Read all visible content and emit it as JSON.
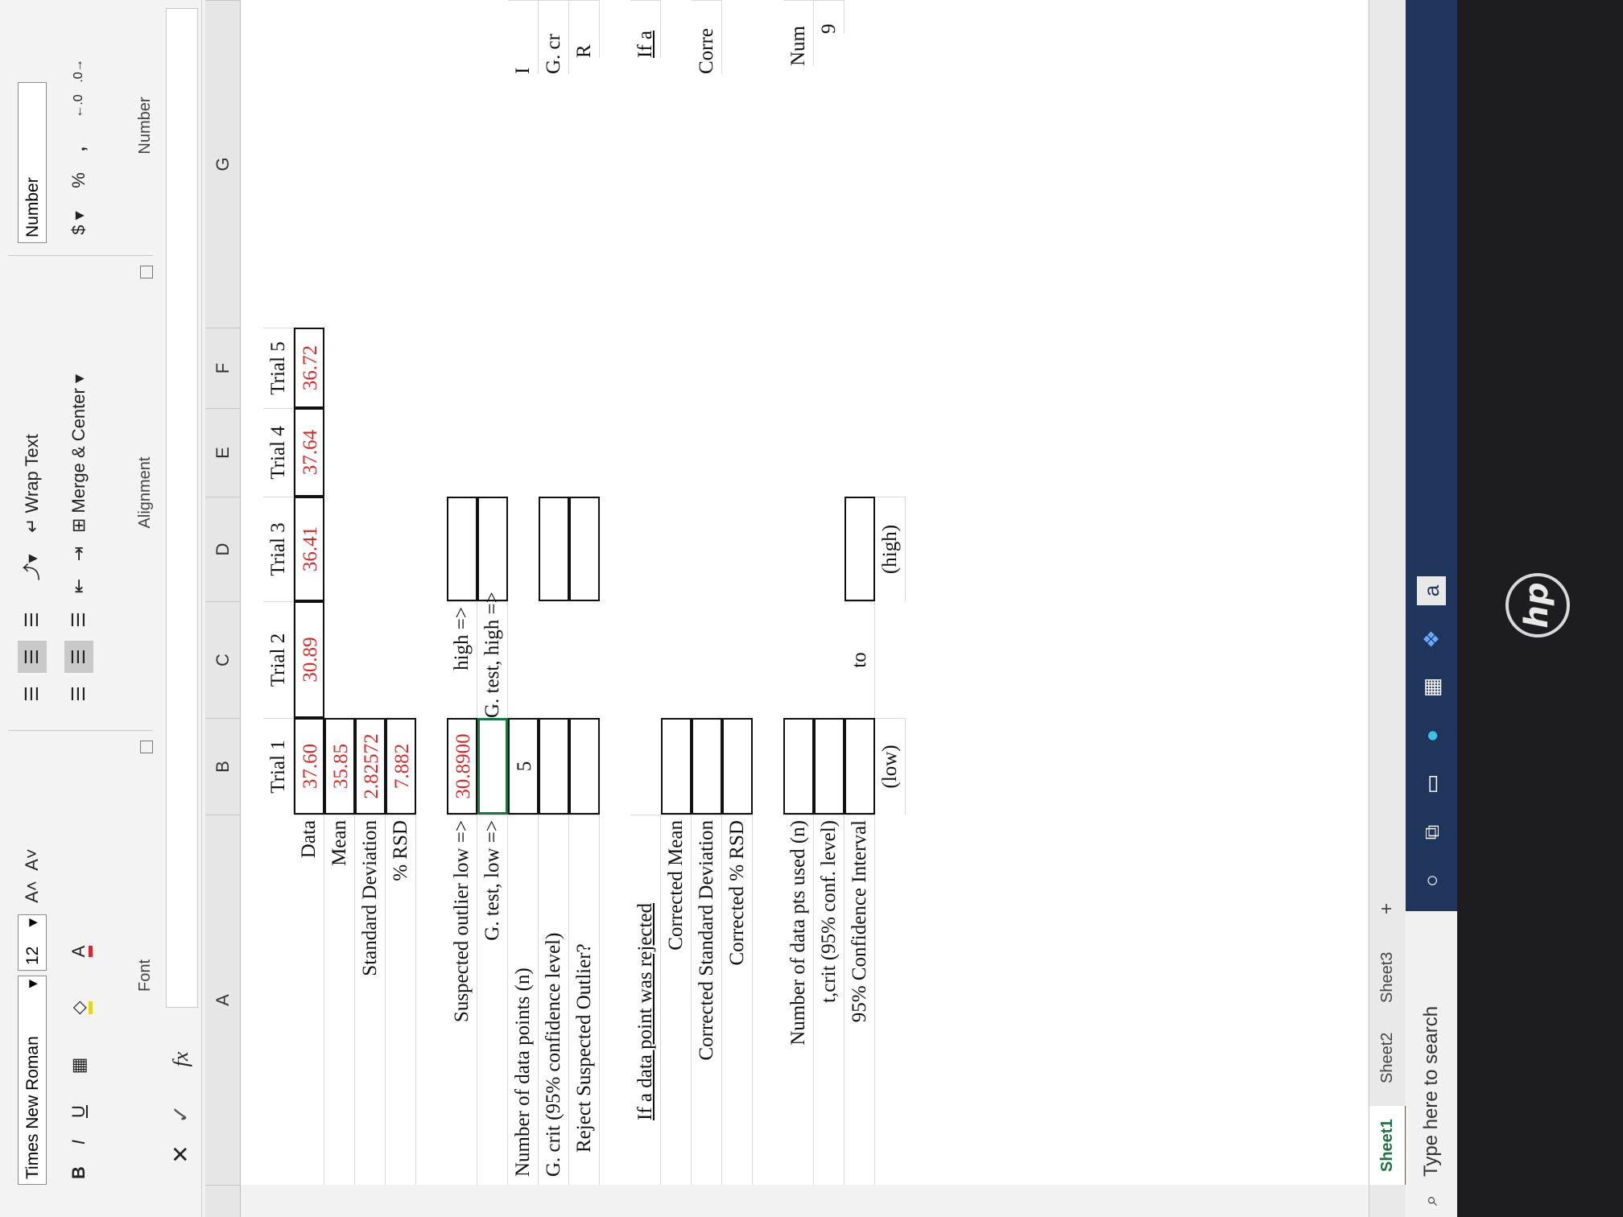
{
  "ribbon": {
    "font_name": "Times New Roman",
    "font_size": "12",
    "grow_font": "A˄",
    "shrink_font": "A˅",
    "bold": "B",
    "italic": "I",
    "underline": "U",
    "font_color_glyph": "A",
    "font_label": "Font",
    "wrap_text": "Wrap Text",
    "merge_center": "Merge & Center",
    "alignment_label": "Alignment",
    "number_format": "Number",
    "currency": "$",
    "percent": "%",
    "comma": ",",
    "number_label": "Number"
  },
  "formula_bar": {
    "fx": "fx"
  },
  "columns": [
    "A",
    "B",
    "C",
    "D",
    "E",
    "F",
    "G"
  ],
  "sheet": {
    "trial_headers": [
      "Trial 1",
      "Trial 2",
      "Trial 3",
      "Trial 4",
      "Trial 5"
    ],
    "data_label": "Data",
    "data_values": [
      "37.60",
      "30.89",
      "36.41",
      "37.64",
      "36.72"
    ],
    "mean_label": "Mean",
    "mean_value": "35.85",
    "sd_label": "Standard Deviation",
    "sd_value": "2.82572",
    "rsd_label": "% RSD",
    "rsd_value": "7.882",
    "outlier_low_label": "Suspected outlier low =>",
    "outlier_low_value": "30.8900",
    "outlier_high_label": "high =>",
    "gtest_low_label": "G. test, low =>",
    "gtest_high_label": "G. test, high =>",
    "n_label": "Number of data points (n)",
    "n_value": "5",
    "gcrit_label": "G. crit (95% confidence level)",
    "reject_label": "Reject Suspected Outlier?",
    "rejected_header": "If a data point was rejected",
    "corrected_mean_label": "Corrected Mean",
    "corrected_sd_label": "Corrected Standard Deviation",
    "corrected_rsd_label": "Corrected % RSD",
    "n_used_label": "Number of data pts used (n)",
    "tcrit_label": "t,crit (95% conf. level)",
    "ci_label": "95% Confidence Interval",
    "to_label": "to",
    "low_label": "(low)",
    "high_label": "(high)",
    "right_fragments": [
      "I",
      "G. cr",
      "R",
      "If a",
      "Corre",
      "Num",
      "9"
    ]
  },
  "tabs": [
    "Sheet1",
    "Sheet2",
    "Sheet3"
  ],
  "add_sheet": "+",
  "taskbar": {
    "search_placeholder": "Type here to search",
    "store_letter": "a"
  },
  "colors": {
    "accent": "#1f7244",
    "data_red": "#d32a2a",
    "taskbar": "#20355c"
  }
}
